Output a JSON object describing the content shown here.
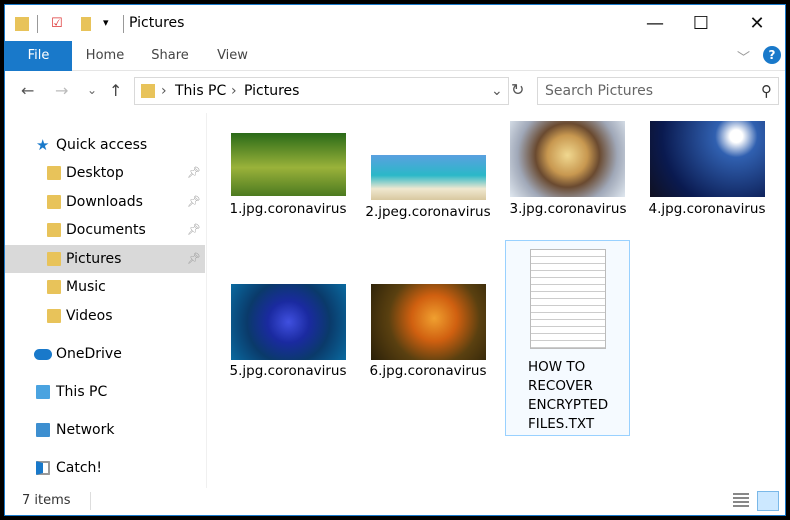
{
  "window": {
    "title": "Pictures",
    "minimize": "—",
    "maximize": "☐",
    "close": "✕",
    "qat_dropdown": "▾"
  },
  "ribbon": {
    "tabs": [
      "File",
      "Home",
      "Share",
      "View"
    ],
    "expand": "﹀",
    "help": "?"
  },
  "address": {
    "back": "←",
    "forward": "→",
    "recent": "⌄",
    "up": "↑",
    "crumbs": [
      "This PC",
      "Pictures"
    ],
    "sep": "›",
    "dropdown": "⌄",
    "refresh": "↻",
    "search_placeholder": "Search Pictures",
    "search_icon": "⚲"
  },
  "sidebar": {
    "items": [
      {
        "label": "Quick access",
        "icon": "star-icon"
      },
      {
        "label": "Desktop",
        "icon": "folder-desktop-icon",
        "pinned": true
      },
      {
        "label": "Downloads",
        "icon": "folder-downloads-icon",
        "pinned": true
      },
      {
        "label": "Documents",
        "icon": "folder-documents-icon",
        "pinned": true
      },
      {
        "label": "Pictures",
        "icon": "folder-pictures-icon",
        "pinned": true,
        "selected": true
      },
      {
        "label": "Music",
        "icon": "folder-music-icon"
      },
      {
        "label": "Videos",
        "icon": "folder-videos-icon"
      },
      {
        "label": "OneDrive",
        "icon": "cloud-icon"
      },
      {
        "label": "This PC",
        "icon": "computer-icon"
      },
      {
        "label": "Network",
        "icon": "network-icon"
      },
      {
        "label": "Catch!",
        "icon": "app-window-icon"
      }
    ]
  },
  "files": [
    {
      "name": "1.jpg.coronavirus"
    },
    {
      "name": "2.jpeg.coronavirus"
    },
    {
      "name": "3.jpg.coronavirus"
    },
    {
      "name": "4.jpg.coronavirus"
    },
    {
      "name": "5.jpg.coronavirus"
    },
    {
      "name": "6.jpg.coronavirus"
    },
    {
      "name": "HOW TO RECOVER ENCRYPTED FILES.TXT",
      "selected": true
    }
  ],
  "status": {
    "count": "7 items"
  },
  "colors": {
    "accent": "#1979ca",
    "selection": "#d9d9d9"
  }
}
